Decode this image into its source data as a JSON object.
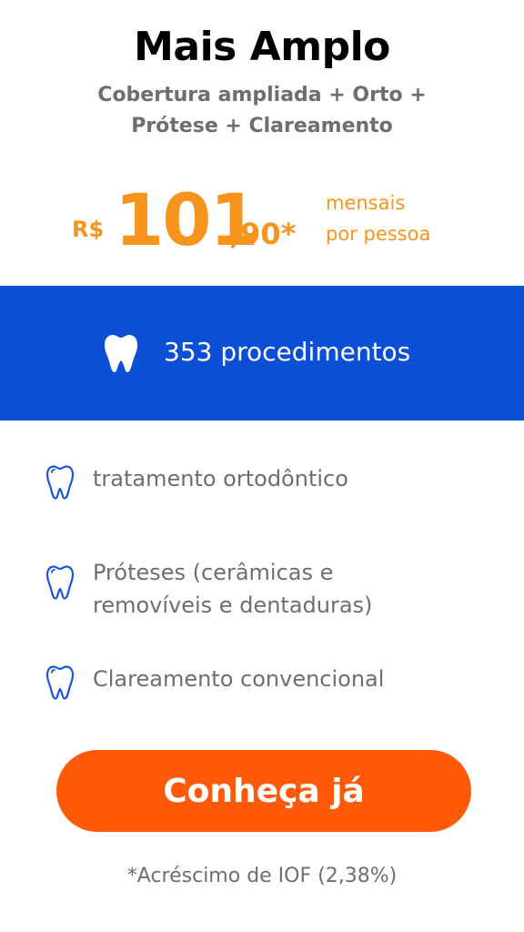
{
  "plan": {
    "title": "Mais Amplo",
    "subtitle_line1": "Cobertura ampliada +  Orto +",
    "subtitle_line2": "Prótese + Clareamento"
  },
  "price": {
    "currency": "R$",
    "integer": "101",
    "decimal": ",90*",
    "note_line1": "mensais",
    "note_line2": "por pessoa"
  },
  "banner": {
    "icon": "tooth-icon",
    "text": "353 procedimentos"
  },
  "features": [
    {
      "icon": "tooth-icon",
      "line1": "tratamento ortodôntico",
      "line2": ""
    },
    {
      "icon": "tooth-icon",
      "line1": "Próteses (cerâmicas e",
      "line2": "removíveis e dentaduras)"
    },
    {
      "icon": "tooth-icon",
      "line1": "Clareamento convencional",
      "line2": ""
    }
  ],
  "cta": {
    "label": "Conheça já"
  },
  "footnote": "*Acréscimo de IOF (2,38%)",
  "colors": {
    "accent_orange": "#f7941d",
    "cta_orange": "#ff5a0a",
    "banner_blue": "#0a4fd6",
    "text_gray": "#6b6e73"
  }
}
